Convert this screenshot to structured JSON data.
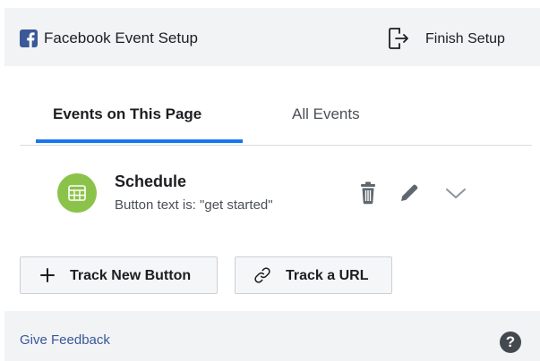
{
  "header": {
    "title": "Facebook Event Setup",
    "finish_label": "Finish Setup"
  },
  "tabs": [
    {
      "label": "Events on This Page",
      "active": true
    },
    {
      "label": "All Events",
      "active": false
    }
  ],
  "events": [
    {
      "name": "Schedule",
      "description": "Button text is: \"get started\"",
      "icon": "calendar-grid-icon"
    }
  ],
  "actions": {
    "track_button_label": "Track New Button",
    "track_url_label": "Track a URL"
  },
  "footer": {
    "feedback_label": "Give Feedback",
    "help_symbol": "?"
  },
  "colors": {
    "brand": "#3b5998",
    "accent": "#1877f2",
    "event_icon_bg": "#8bc34a",
    "link": "#385898"
  }
}
